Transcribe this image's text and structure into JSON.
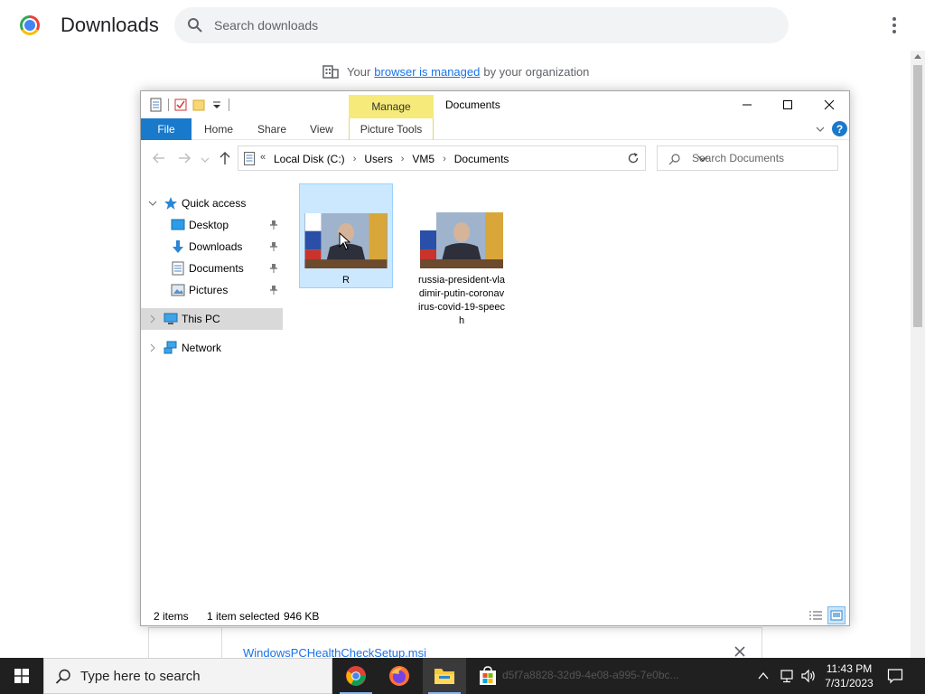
{
  "chrome": {
    "title": "Downloads",
    "search_placeholder": "Search downloads",
    "managed": {
      "prefix": "Your",
      "link": "browser is managed",
      "suffix": "by your organization"
    },
    "download_item": {
      "filename": "WindowsPCHealthCheckSetup.msi"
    }
  },
  "explorer": {
    "window_title": "Documents",
    "context_tab": "Manage",
    "ribbon_tabs": {
      "file": "File",
      "home": "Home",
      "share": "Share",
      "view": "View",
      "picture_tools": "Picture Tools"
    },
    "address": {
      "overflow": "«",
      "crumbs": [
        "Local Disk (C:)",
        "Users",
        "VM5",
        "Documents"
      ]
    },
    "search_placeholder": "Search Documents",
    "nav": {
      "quick_access": "Quick access",
      "desktop": "Desktop",
      "downloads": "Downloads",
      "documents": "Documents",
      "pictures": "Pictures",
      "this_pc": "This PC",
      "network": "Network"
    },
    "files": [
      {
        "name": "R",
        "selected": true
      },
      {
        "name": "russia-president-vladimir-putin-coronavirus-covid-19-speech",
        "selected": false
      }
    ],
    "status": {
      "count": "2 items",
      "selected": "1 item selected",
      "size": "946 KB"
    }
  },
  "taskbar": {
    "search_placeholder": "Type here to search",
    "ghost_text": "d5f7a8828-32d9-4e08-a995-7e0bc...",
    "time": "11:43 PM",
    "date": "7/31/2023"
  },
  "colors": {
    "accent_blue": "#1979ca",
    "manage_yellow": "#f6eb7a",
    "selection": "#cce8ff",
    "link": "#1a73e8",
    "taskbar": "#202020"
  }
}
